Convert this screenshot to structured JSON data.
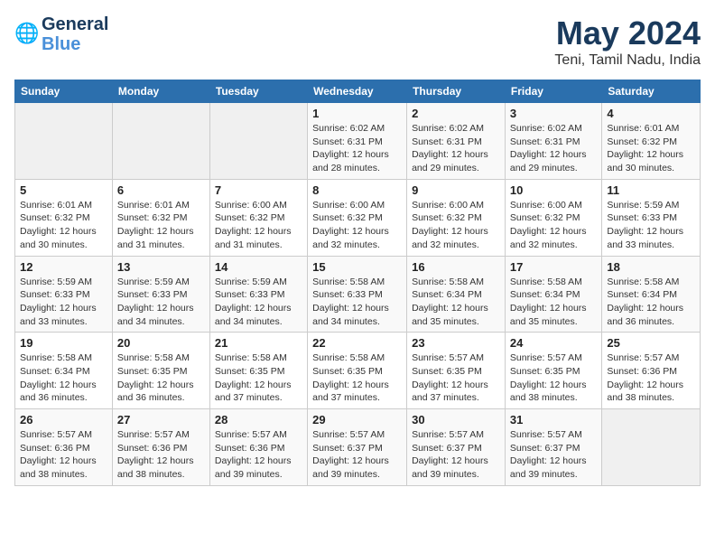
{
  "header": {
    "logo_line1": "General",
    "logo_line2": "Blue",
    "title": "May 2024",
    "subtitle": "Teni, Tamil Nadu, India"
  },
  "days_of_week": [
    "Sunday",
    "Monday",
    "Tuesday",
    "Wednesday",
    "Thursday",
    "Friday",
    "Saturday"
  ],
  "weeks": [
    [
      {
        "day": "",
        "info": ""
      },
      {
        "day": "",
        "info": ""
      },
      {
        "day": "",
        "info": ""
      },
      {
        "day": "1",
        "info": "Sunrise: 6:02 AM\nSunset: 6:31 PM\nDaylight: 12 hours\nand 28 minutes."
      },
      {
        "day": "2",
        "info": "Sunrise: 6:02 AM\nSunset: 6:31 PM\nDaylight: 12 hours\nand 29 minutes."
      },
      {
        "day": "3",
        "info": "Sunrise: 6:02 AM\nSunset: 6:31 PM\nDaylight: 12 hours\nand 29 minutes."
      },
      {
        "day": "4",
        "info": "Sunrise: 6:01 AM\nSunset: 6:32 PM\nDaylight: 12 hours\nand 30 minutes."
      }
    ],
    [
      {
        "day": "5",
        "info": "Sunrise: 6:01 AM\nSunset: 6:32 PM\nDaylight: 12 hours\nand 30 minutes."
      },
      {
        "day": "6",
        "info": "Sunrise: 6:01 AM\nSunset: 6:32 PM\nDaylight: 12 hours\nand 31 minutes."
      },
      {
        "day": "7",
        "info": "Sunrise: 6:00 AM\nSunset: 6:32 PM\nDaylight: 12 hours\nand 31 minutes."
      },
      {
        "day": "8",
        "info": "Sunrise: 6:00 AM\nSunset: 6:32 PM\nDaylight: 12 hours\nand 32 minutes."
      },
      {
        "day": "9",
        "info": "Sunrise: 6:00 AM\nSunset: 6:32 PM\nDaylight: 12 hours\nand 32 minutes."
      },
      {
        "day": "10",
        "info": "Sunrise: 6:00 AM\nSunset: 6:32 PM\nDaylight: 12 hours\nand 32 minutes."
      },
      {
        "day": "11",
        "info": "Sunrise: 5:59 AM\nSunset: 6:33 PM\nDaylight: 12 hours\nand 33 minutes."
      }
    ],
    [
      {
        "day": "12",
        "info": "Sunrise: 5:59 AM\nSunset: 6:33 PM\nDaylight: 12 hours\nand 33 minutes."
      },
      {
        "day": "13",
        "info": "Sunrise: 5:59 AM\nSunset: 6:33 PM\nDaylight: 12 hours\nand 34 minutes."
      },
      {
        "day": "14",
        "info": "Sunrise: 5:59 AM\nSunset: 6:33 PM\nDaylight: 12 hours\nand 34 minutes."
      },
      {
        "day": "15",
        "info": "Sunrise: 5:58 AM\nSunset: 6:33 PM\nDaylight: 12 hours\nand 34 minutes."
      },
      {
        "day": "16",
        "info": "Sunrise: 5:58 AM\nSunset: 6:34 PM\nDaylight: 12 hours\nand 35 minutes."
      },
      {
        "day": "17",
        "info": "Sunrise: 5:58 AM\nSunset: 6:34 PM\nDaylight: 12 hours\nand 35 minutes."
      },
      {
        "day": "18",
        "info": "Sunrise: 5:58 AM\nSunset: 6:34 PM\nDaylight: 12 hours\nand 36 minutes."
      }
    ],
    [
      {
        "day": "19",
        "info": "Sunrise: 5:58 AM\nSunset: 6:34 PM\nDaylight: 12 hours\nand 36 minutes."
      },
      {
        "day": "20",
        "info": "Sunrise: 5:58 AM\nSunset: 6:35 PM\nDaylight: 12 hours\nand 36 minutes."
      },
      {
        "day": "21",
        "info": "Sunrise: 5:58 AM\nSunset: 6:35 PM\nDaylight: 12 hours\nand 37 minutes."
      },
      {
        "day": "22",
        "info": "Sunrise: 5:58 AM\nSunset: 6:35 PM\nDaylight: 12 hours\nand 37 minutes."
      },
      {
        "day": "23",
        "info": "Sunrise: 5:57 AM\nSunset: 6:35 PM\nDaylight: 12 hours\nand 37 minutes."
      },
      {
        "day": "24",
        "info": "Sunrise: 5:57 AM\nSunset: 6:35 PM\nDaylight: 12 hours\nand 38 minutes."
      },
      {
        "day": "25",
        "info": "Sunrise: 5:57 AM\nSunset: 6:36 PM\nDaylight: 12 hours\nand 38 minutes."
      }
    ],
    [
      {
        "day": "26",
        "info": "Sunrise: 5:57 AM\nSunset: 6:36 PM\nDaylight: 12 hours\nand 38 minutes."
      },
      {
        "day": "27",
        "info": "Sunrise: 5:57 AM\nSunset: 6:36 PM\nDaylight: 12 hours\nand 38 minutes."
      },
      {
        "day": "28",
        "info": "Sunrise: 5:57 AM\nSunset: 6:36 PM\nDaylight: 12 hours\nand 39 minutes."
      },
      {
        "day": "29",
        "info": "Sunrise: 5:57 AM\nSunset: 6:37 PM\nDaylight: 12 hours\nand 39 minutes."
      },
      {
        "day": "30",
        "info": "Sunrise: 5:57 AM\nSunset: 6:37 PM\nDaylight: 12 hours\nand 39 minutes."
      },
      {
        "day": "31",
        "info": "Sunrise: 5:57 AM\nSunset: 6:37 PM\nDaylight: 12 hours\nand 39 minutes."
      },
      {
        "day": "",
        "info": ""
      }
    ]
  ]
}
